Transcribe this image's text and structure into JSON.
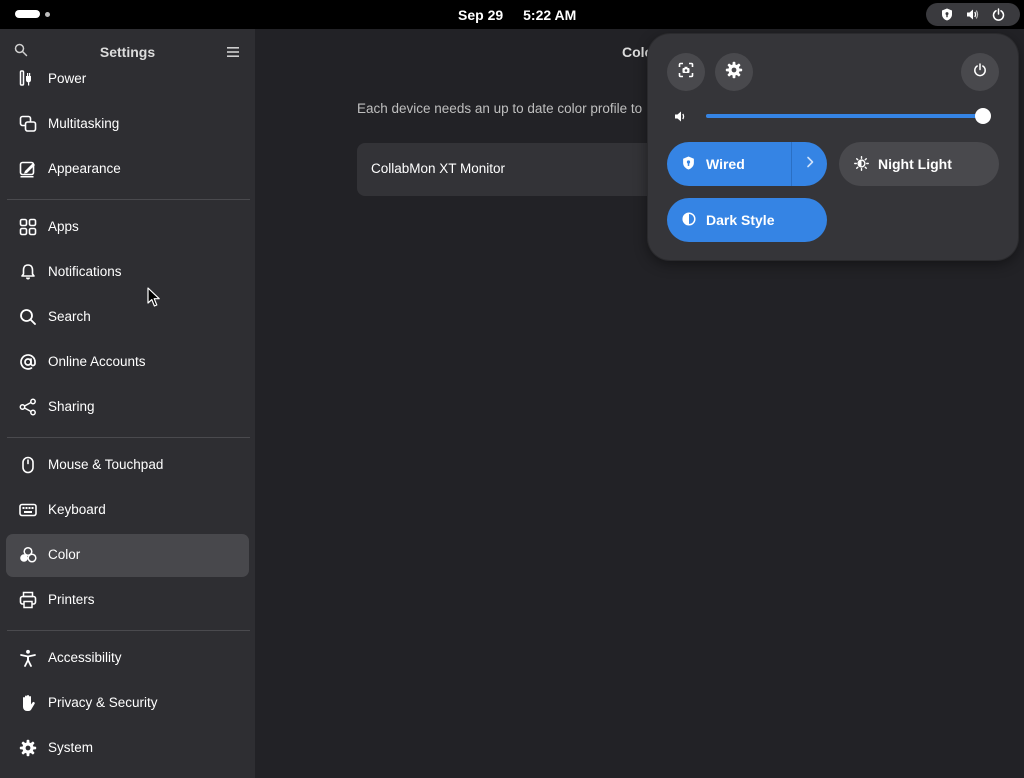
{
  "topbar": {
    "date": "Sep 29",
    "time": "5:22 AM",
    "status_icons": [
      "vpn-shield-icon",
      "volume-icon",
      "power-icon"
    ]
  },
  "sidebar": {
    "title": "Settings",
    "items": [
      {
        "label": "Power",
        "icon": "power-plug-icon"
      },
      {
        "label": "Multitasking",
        "icon": "multitasking-icon"
      },
      {
        "label": "Appearance",
        "icon": "appearance-icon"
      },
      {
        "label": "Apps",
        "icon": "apps-grid-icon"
      },
      {
        "label": "Notifications",
        "icon": "bell-icon"
      },
      {
        "label": "Search",
        "icon": "search-icon"
      },
      {
        "label": "Online Accounts",
        "icon": "at-sign-icon"
      },
      {
        "label": "Sharing",
        "icon": "share-icon"
      },
      {
        "label": "Mouse & Touchpad",
        "icon": "mouse-icon"
      },
      {
        "label": "Keyboard",
        "icon": "keyboard-icon"
      },
      {
        "label": "Color",
        "icon": "color-icon",
        "active": true
      },
      {
        "label": "Printers",
        "icon": "printer-icon"
      },
      {
        "label": "Accessibility",
        "icon": "accessibility-icon"
      },
      {
        "label": "Privacy & Security",
        "icon": "hand-icon"
      },
      {
        "label": "System",
        "icon": "gear-icon"
      }
    ]
  },
  "main": {
    "title": "Color",
    "description": "Each device needs an up to date color profile to",
    "devices": [
      {
        "name": "CollabMon XT Monitor"
      }
    ]
  },
  "quick_settings": {
    "volume_level": 0.99,
    "toggles": {
      "wired": {
        "label": "Wired",
        "on": true
      },
      "night_light": {
        "label": "Night Light",
        "on": false
      },
      "dark_style": {
        "label": "Dark Style",
        "on": true
      }
    }
  },
  "colors": {
    "accent": "#3584e4",
    "sidebar_bg": "#2e2e32",
    "main_bg": "#222226",
    "popover_bg": "#353539"
  }
}
